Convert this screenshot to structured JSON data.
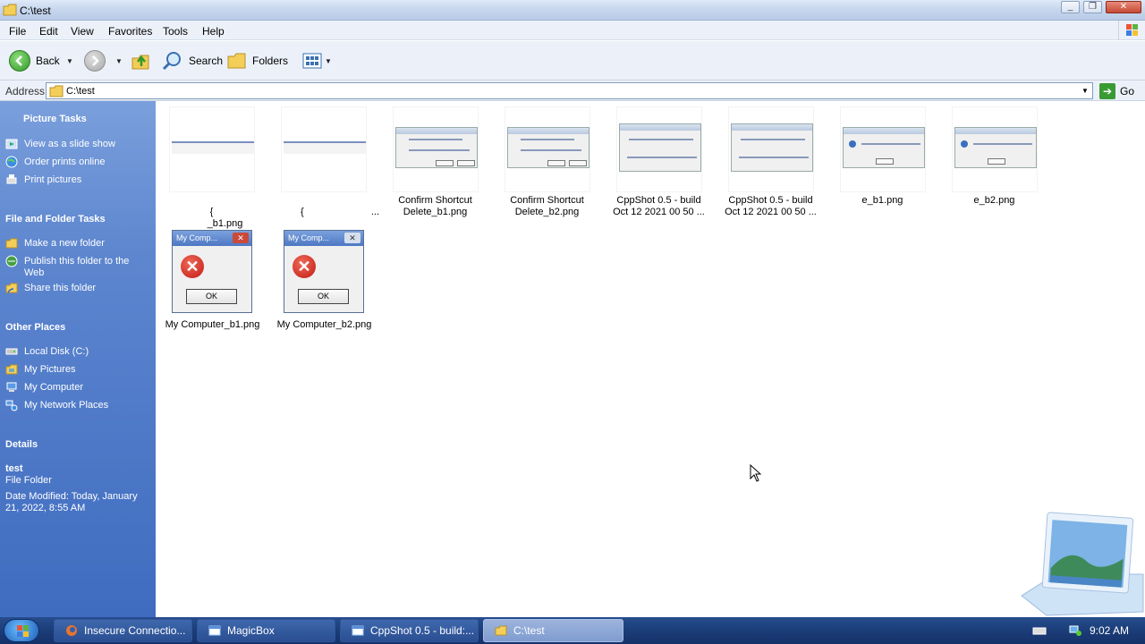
{
  "window": {
    "title": "C:\\test"
  },
  "menu": [
    "File",
    "Edit",
    "View",
    "Favorites",
    "Tools",
    "Help"
  ],
  "toolbar": {
    "back": "Back",
    "search": "Search",
    "folders": "Folders"
  },
  "address": {
    "label": "Address",
    "value": "C:\\test",
    "go": "Go"
  },
  "sidebar": {
    "picture_tasks": {
      "title": "Picture Tasks",
      "items": [
        "View as a slide show",
        "Order prints online",
        "Print pictures"
      ]
    },
    "file_folder_tasks": {
      "title": "File and Folder Tasks",
      "items": [
        "Make a new folder",
        "Publish this folder to the Web",
        "Share this folder"
      ]
    },
    "other_places": {
      "title": "Other Places",
      "items": [
        "Local Disk (C:)",
        "My Pictures",
        "My Computer",
        "My Network Places"
      ]
    },
    "details": {
      "title": "Details",
      "name": "test",
      "type": "File Folder",
      "modified": "Date Modified: Today, January 21, 2022, 8:55 AM"
    }
  },
  "files": [
    {
      "name_line1": "{",
      "name_line2": "_b1.png"
    },
    {
      "name_line1": "{",
      "name_line2": "..."
    },
    {
      "name_line1": "Confirm Shortcut",
      "name_line2": "Delete_b1.png"
    },
    {
      "name_line1": "Confirm Shortcut",
      "name_line2": "Delete_b2.png"
    },
    {
      "name_line1": "CppShot 0.5 - build",
      "name_line2": "Oct 12 2021 00 50 ..."
    },
    {
      "name_line1": "CppShot 0.5 - build",
      "name_line2": "Oct 12 2021 00 50 ..."
    },
    {
      "name_line1": "e_b1.png",
      "name_line2": ""
    },
    {
      "name_line1": "e_b2.png",
      "name_line2": ""
    },
    {
      "name_line1": "My Computer_b1.png",
      "name_line2": "",
      "dialog_title": "My Comp...",
      "ok": "OK"
    },
    {
      "name_line1": "My Computer_b2.png",
      "name_line2": "",
      "dialog_title": "My Comp...",
      "ok": "OK"
    }
  ],
  "taskbar": {
    "buttons": [
      "Insecure Connectio...",
      "MagicBox",
      "CppShot 0.5 - build:...",
      "C:\\test"
    ],
    "clock": "9:02 AM"
  }
}
